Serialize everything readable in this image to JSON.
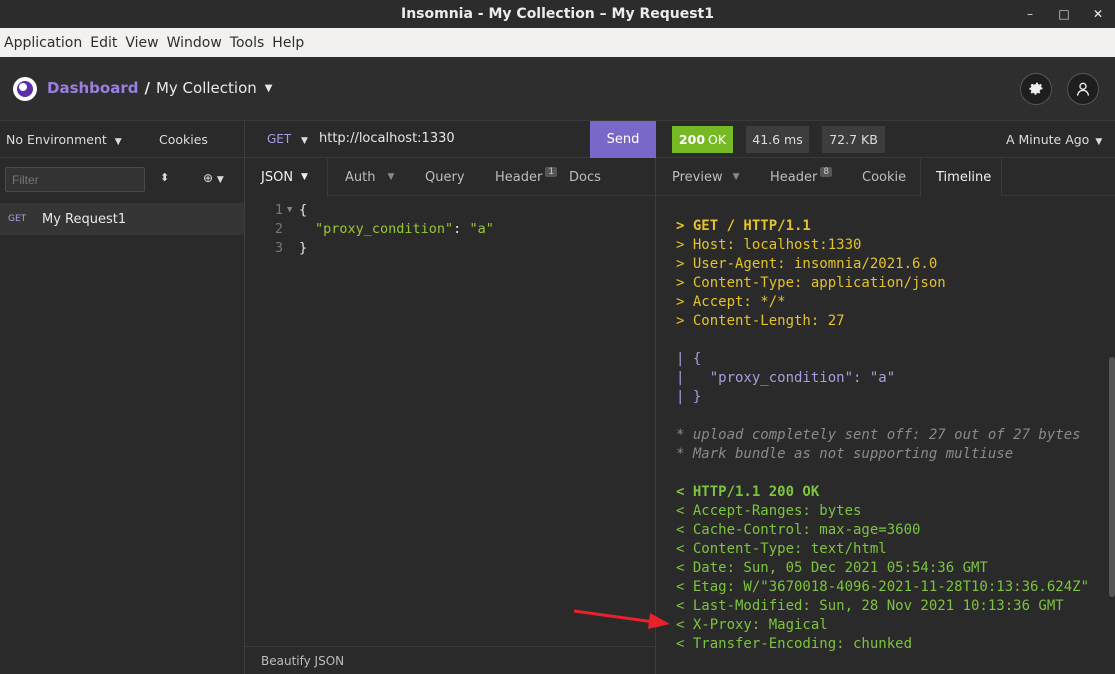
{
  "window": {
    "title": "Insomnia - My Collection – My Request1",
    "controls": [
      "–",
      "□",
      "✕"
    ]
  },
  "menu": [
    "Application",
    "Edit",
    "View",
    "Window",
    "Tools",
    "Help"
  ],
  "header": {
    "dashboard": "Dashboard",
    "separator": "/",
    "collection": "My Collection"
  },
  "sidebar": {
    "environment": "No Environment",
    "cookies": "Cookies",
    "filter_placeholder": "Filter",
    "requests": [
      {
        "method": "GET",
        "name": "My Request1"
      }
    ]
  },
  "request": {
    "method": "GET",
    "url": "http://localhost:1330",
    "send_label": "Send",
    "tabs": {
      "body": "JSON",
      "auth": "Auth",
      "query": "Query",
      "header": "Header",
      "header_count": "1",
      "docs": "Docs"
    },
    "body_lines": [
      {
        "num": "1",
        "text": "{"
      },
      {
        "num": "2",
        "key": "\"proxy_condition\"",
        "value": "\"a\""
      },
      {
        "num": "3",
        "text": "}"
      }
    ],
    "beautify": "Beautify JSON"
  },
  "response": {
    "status_code": "200",
    "status_text": "OK",
    "time": "41.6 ms",
    "size": "72.7 KB",
    "when": "A Minute Ago",
    "tabs": {
      "preview": "Preview",
      "header": "Header",
      "header_count": "8",
      "cookie": "Cookie",
      "timeline": "Timeline"
    },
    "timeline": [
      {
        "type": "out",
        "text": "> GET / HTTP/1.1",
        "bold": true
      },
      {
        "type": "out",
        "text": "> Host: localhost:1330"
      },
      {
        "type": "out",
        "text": "> User-Agent: insomnia/2021.6.0"
      },
      {
        "type": "out",
        "text": "> Content-Type: application/json"
      },
      {
        "type": "out",
        "text": "> Accept: */*"
      },
      {
        "type": "out",
        "text": "> Content-Length: 27"
      },
      {
        "type": "blank",
        "text": ""
      },
      {
        "type": "data",
        "text": "| {"
      },
      {
        "type": "data",
        "text": "|   \"proxy_condition\": \"a\""
      },
      {
        "type": "data",
        "text": "| }"
      },
      {
        "type": "blank",
        "text": ""
      },
      {
        "type": "info",
        "text": "* upload completely sent off: 27 out of 27 bytes"
      },
      {
        "type": "info",
        "text": "* Mark bundle as not supporting multiuse"
      },
      {
        "type": "blank",
        "text": ""
      },
      {
        "type": "in",
        "text": "< HTTP/1.1 200 OK",
        "bold": true
      },
      {
        "type": "in",
        "text": "< Accept-Ranges: bytes"
      },
      {
        "type": "in",
        "text": "< Cache-Control: max-age=3600"
      },
      {
        "type": "in",
        "text": "< Content-Type: text/html"
      },
      {
        "type": "in",
        "text": "< Date: Sun, 05 Dec 2021 05:54:36 GMT"
      },
      {
        "type": "in",
        "text": "< Etag: W/\"3670018-4096-2021-11-28T10:13:36.624Z\""
      },
      {
        "type": "in",
        "text": "< Last-Modified: Sun, 28 Nov 2021 10:13:36 GMT"
      },
      {
        "type": "in",
        "text": "< X-Proxy: Magical"
      },
      {
        "type": "in",
        "text": "< Transfer-Encoding: chunked"
      }
    ]
  },
  "colors": {
    "accent": "#7a68c8",
    "ok": "#75ba24",
    "annotation_arrow": "#e8212a"
  }
}
